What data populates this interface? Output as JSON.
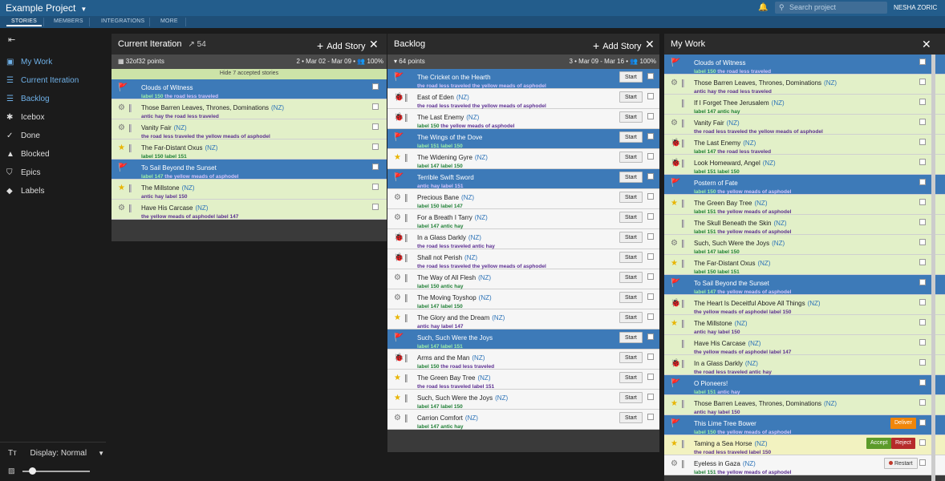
{
  "topbar": {
    "project": "Example Project",
    "search_placeholder": "Search project",
    "user": "NESHA ZORIC",
    "tabs": [
      "STORIES",
      "MEMBERS",
      "INTEGRATIONS",
      "MORE"
    ]
  },
  "sidebar": {
    "items": [
      "My Work",
      "Current Iteration",
      "Backlog",
      "Icebox",
      "Done",
      "Blocked",
      "Epics",
      "Labels"
    ],
    "display": "Display:",
    "display_value": "Normal"
  },
  "current": {
    "title": "Current Iteration",
    "velocity": "54",
    "add": "Add Story",
    "points": "32of32 points",
    "iter": "2 • Mar 02 - Mar 09 •",
    "pct": "100%",
    "hide": "Hide 7 accepted stories",
    "stories": [
      {
        "t": "Clouds of Witness",
        "nz": "",
        "l1": "label 150",
        "l2": "the road less traveled",
        "kind": "rel",
        "icon": "release"
      },
      {
        "t": "Those Barren Leaves, Thrones, Dominations",
        "nz": "(NZ)",
        "l1": "",
        "l2": "antic hay the road less traveled",
        "kind": "acc",
        "icon": "chore"
      },
      {
        "t": "Vanity Fair",
        "nz": "(NZ)",
        "l1": "",
        "l2": "the road less traveled the yellow meads of asphodel",
        "kind": "acc",
        "icon": "chore"
      },
      {
        "t": "The Far-Distant Oxus",
        "nz": "(NZ)",
        "l1": "label 150 label 151",
        "l2": "",
        "kind": "acc",
        "icon": "feature"
      },
      {
        "t": "To Sail Beyond the Sunset",
        "nz": "",
        "l1": "label 147",
        "l2": "the yellow meads of asphodel",
        "kind": "rel",
        "icon": "release"
      },
      {
        "t": "The Millstone",
        "nz": "(NZ)",
        "l1": "",
        "l2": "antic hay label 150",
        "kind": "acc",
        "icon": "feature"
      },
      {
        "t": "Have His Carcase",
        "nz": "(NZ)",
        "l1": "",
        "l2": "the yellow meads of asphodel label 147",
        "kind": "acc",
        "icon": "chore"
      }
    ]
  },
  "backlog": {
    "title": "Backlog",
    "add": "Add Story",
    "points": "64 points",
    "iter": "3 • Mar 09 - Mar 16 •",
    "pct": "100%",
    "start": "Start",
    "stories": [
      {
        "t": "The Cricket on the Hearth",
        "nz": "",
        "l1": "",
        "l2": "the road less traveled the yellow meads of asphodel",
        "kind": "rel",
        "icon": "release"
      },
      {
        "t": "East of Eden",
        "nz": "(NZ)",
        "l1": "",
        "l2": "the road less traveled the yellow meads of asphodel",
        "kind": "unst",
        "icon": "bug"
      },
      {
        "t": "The Last Enemy",
        "nz": "(NZ)",
        "l1": "label 150",
        "l2": "the yellow meads of asphodel",
        "kind": "unst",
        "icon": "bug"
      },
      {
        "t": "The Wings of the Dove",
        "nz": "",
        "l1": "label 151 label 150",
        "l2": "",
        "kind": "rel",
        "icon": "release"
      },
      {
        "t": "The Widening Gyre",
        "nz": "(NZ)",
        "l1": "label 147 label 150",
        "l2": "",
        "kind": "unst",
        "icon": "feature"
      },
      {
        "t": "Terrible Swift Sword",
        "nz": "",
        "l1": "",
        "l2": "antic hay label 151",
        "kind": "rel",
        "icon": "release"
      },
      {
        "t": "Precious Bane",
        "nz": "(NZ)",
        "l1": "label 150 label 147",
        "l2": "",
        "kind": "unst",
        "icon": "chore"
      },
      {
        "t": "For a Breath I Tarry",
        "nz": "(NZ)",
        "l1": "label 147 antic hay",
        "l2": "",
        "kind": "unst",
        "icon": "chore"
      },
      {
        "t": "In a Glass Darkly",
        "nz": "(NZ)",
        "l1": "",
        "l2": "the road less traveled antic hay",
        "kind": "unst",
        "icon": "bug"
      },
      {
        "t": "Shall not Perish",
        "nz": "(NZ)",
        "l1": "",
        "l2": "the road less traveled the yellow meads of asphodel",
        "kind": "unst",
        "icon": "bug"
      },
      {
        "t": "The Way of All Flesh",
        "nz": "(NZ)",
        "l1": "label 150 antic hay",
        "l2": "",
        "kind": "unst",
        "icon": "chore"
      },
      {
        "t": "The Moving Toyshop",
        "nz": "(NZ)",
        "l1": "label 147 label 150",
        "l2": "",
        "kind": "unst",
        "icon": "chore"
      },
      {
        "t": "The Glory and the Dream",
        "nz": "(NZ)",
        "l1": "",
        "l2": "antic hay label 147",
        "kind": "unst",
        "icon": "feature"
      },
      {
        "t": "Such, Such Were the Joys",
        "nz": "",
        "l1": "label 147 label 151",
        "l2": "",
        "kind": "rel",
        "icon": "release"
      },
      {
        "t": "Arms and the Man",
        "nz": "(NZ)",
        "l1": "label 150",
        "l2": "the road less traveled",
        "kind": "unst",
        "icon": "bug"
      },
      {
        "t": "The Green Bay Tree",
        "nz": "(NZ)",
        "l1": "",
        "l2": "the road less traveled label 151",
        "kind": "unst",
        "icon": "feature"
      },
      {
        "t": "Such, Such Were the Joys",
        "nz": "(NZ)",
        "l1": "label 147 label 150",
        "l2": "",
        "kind": "unst",
        "icon": "feature"
      },
      {
        "t": "Carrion Comfort",
        "nz": "(NZ)",
        "l1": "label 147 antic hay",
        "l2": "",
        "kind": "unst",
        "icon": "chore"
      }
    ]
  },
  "mywork": {
    "title": "My Work",
    "deliver": "Deliver",
    "accept": "Accept",
    "reject": "Reject",
    "restart": "Restart",
    "stories": [
      {
        "t": "Clouds of Witness",
        "nz": "",
        "l1": "label 150",
        "l2": "the road less traveled",
        "kind": "rel",
        "icon": "release"
      },
      {
        "t": "Those Barren Leaves, Thrones, Dominations",
        "nz": "(NZ)",
        "l1": "",
        "l2": "antic hay the road less traveled",
        "kind": "acc",
        "icon": "chore"
      },
      {
        "t": "If I Forget Thee Jerusalem",
        "nz": "(NZ)",
        "l1": "label 147 antic hay",
        "l2": "",
        "kind": "acc",
        "icon": "none"
      },
      {
        "t": "Vanity Fair",
        "nz": "(NZ)",
        "l1": "",
        "l2": "the road less traveled the yellow meads of asphodel",
        "kind": "acc",
        "icon": "chore"
      },
      {
        "t": "The Last Enemy",
        "nz": "(NZ)",
        "l1": "label 147",
        "l2": "the road less traveled",
        "kind": "acc",
        "icon": "bug"
      },
      {
        "t": "Look Homeward, Angel",
        "nz": "(NZ)",
        "l1": "label 151 label 150",
        "l2": "",
        "kind": "acc",
        "icon": "bug"
      },
      {
        "t": "Postern of Fate",
        "nz": "",
        "l1": "label 150",
        "l2": "the yellow meads of asphodel",
        "kind": "rel",
        "icon": "release"
      },
      {
        "t": "The Green Bay Tree",
        "nz": "(NZ)",
        "l1": "label 151",
        "l2": "the yellow meads of asphodel",
        "kind": "acc",
        "icon": "feature"
      },
      {
        "t": "The Skull Beneath the Skin",
        "nz": "(NZ)",
        "l1": "label 151",
        "l2": "the yellow meads of asphodel",
        "kind": "acc",
        "icon": "none"
      },
      {
        "t": "Such, Such Were the Joys",
        "nz": "(NZ)",
        "l1": "label 147 label 150",
        "l2": "",
        "kind": "acc",
        "icon": "chore"
      },
      {
        "t": "The Far-Distant Oxus",
        "nz": "(NZ)",
        "l1": "label 150 label 151",
        "l2": "",
        "kind": "acc",
        "icon": "feature"
      },
      {
        "t": "To Sail Beyond the Sunset",
        "nz": "",
        "l1": "label 147",
        "l2": "the yellow meads of asphodel",
        "kind": "rel",
        "icon": "release"
      },
      {
        "t": "The Heart Is Deceitful Above All Things",
        "nz": "(NZ)",
        "l1": "",
        "l2": "the yellow meads of asphodel label 150",
        "kind": "acc",
        "icon": "bug"
      },
      {
        "t": "The Millstone",
        "nz": "(NZ)",
        "l1": "",
        "l2": "antic hay label 150",
        "kind": "acc",
        "icon": "feature"
      },
      {
        "t": "Have His Carcase",
        "nz": "(NZ)",
        "l1": "",
        "l2": "the yellow meads of asphodel label 147",
        "kind": "acc",
        "icon": "none"
      },
      {
        "t": "In a Glass Darkly",
        "nz": "(NZ)",
        "l1": "",
        "l2": "the road less traveled antic hay",
        "kind": "acc",
        "icon": "bug"
      },
      {
        "t": "O Pioneers!",
        "nz": "",
        "l1": "label 151",
        "l2": "antic hay",
        "kind": "rel",
        "icon": "release"
      },
      {
        "t": "Those Barren Leaves, Thrones, Dominations",
        "nz": "(NZ)",
        "l1": "",
        "l2": "antic hay label 150",
        "kind": "acc",
        "icon": "feature"
      },
      {
        "t": "This Lime Tree Bower",
        "nz": "",
        "l1": "label 150",
        "l2": "the yellow meads of asphodel",
        "kind": "rel",
        "icon": "release",
        "action": "deliver"
      },
      {
        "t": "Taming a Sea Horse",
        "nz": "(NZ)",
        "l1": "",
        "l2": "the road less traveled label 150",
        "kind": "finished",
        "icon": "feature",
        "action": "acceptreject"
      },
      {
        "t": "Eyeless in Gaza",
        "nz": "(NZ)",
        "l1": "label 151",
        "l2": "the yellow meads of asphodel",
        "kind": "unst",
        "icon": "chore",
        "action": "restart"
      }
    ]
  }
}
